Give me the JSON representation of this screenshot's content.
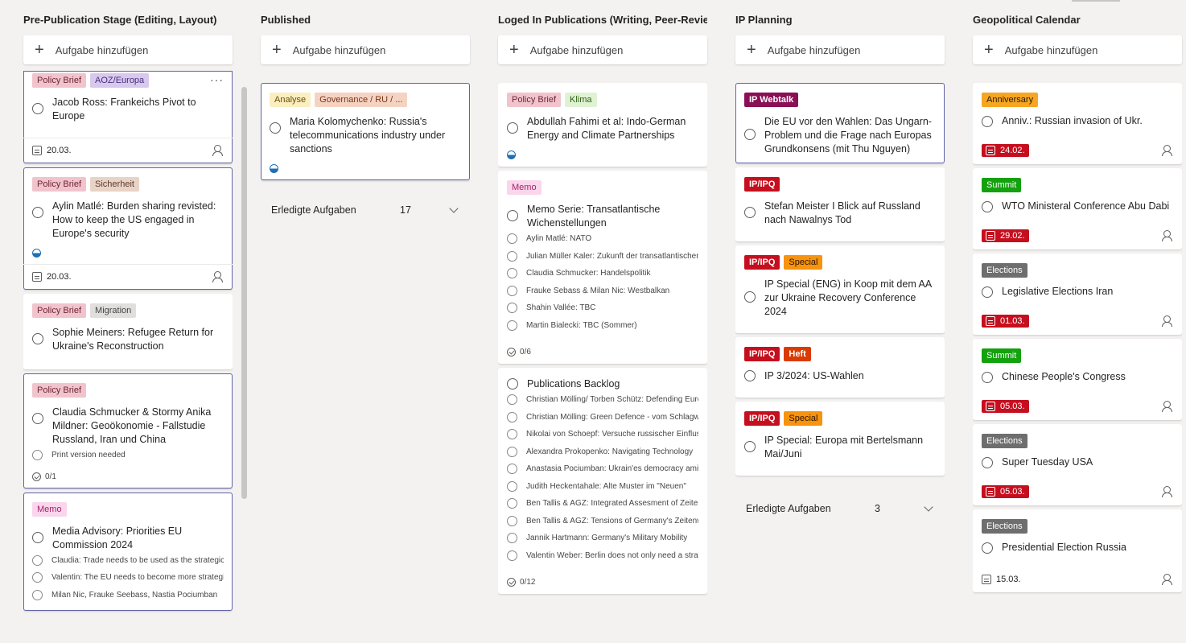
{
  "columns": [
    {
      "title": "Pre-Publication Stage (Editing, Layout)",
      "add_label": "Aufgabe hinzufügen",
      "cards": [
        {
          "labels": [
            {
              "text": "Policy Brief",
              "color": "#f1c4cd"
            },
            {
              "text": "AOZ/Europa",
              "color": "#d8c8ee"
            }
          ],
          "title": "Jacob Ross: Frankeichs Pivot to Europe",
          "date": "20.03.",
          "more": "···"
        },
        {
          "labels": [
            {
              "text": "Policy Brief",
              "color": "#f1c4cd"
            },
            {
              "text": "Sicherheit",
              "color": "#e8d3c7"
            }
          ],
          "title": "Aylin Matlé: Burden sharing revisted: How to keep the US engaged in Europe's security",
          "date": "20.03."
        },
        {
          "labels": [
            {
              "text": "Policy Brief",
              "color": "#f1c4cd"
            },
            {
              "text": "Migration",
              "color": "#e1dfdd"
            }
          ],
          "title": "Sophie Meiners: Refugee Return for Ukraine's Reconstruction"
        },
        {
          "labels": [
            {
              "text": "Policy Brief",
              "color": "#f1c4cd"
            }
          ],
          "title": "Claudia Schmucker & Stormy Anika Mildner: Geoökonomie - Fallstudie Russland, Iran und China",
          "subtasks": [
            "Print version needed"
          ],
          "checklist": "0/1"
        },
        {
          "labels": [
            {
              "text": "Memo",
              "color": "#fbd5ec"
            }
          ],
          "title": "Media Advisory: Priorities EU Commission 2024",
          "subtasks": [
            "Claudia: Trade needs to be used as the strategic tool",
            "Valentin: The EU needs to become more strategic",
            "Milan Nic, Frauke Seebass, Nastia Pociumban"
          ]
        }
      ]
    },
    {
      "title": "Published",
      "add_label": "Aufgabe hinzufügen",
      "cards": [
        {
          "labels": [
            {
              "text": "Analyse",
              "color": "#fbefc1"
            },
            {
              "text": "Governance / RU / ...",
              "color": "#f5d3c2"
            }
          ],
          "title": "Maria Kolomychenko: Russia's telecommunications industry under sanctions"
        }
      ],
      "completed_label": "Erledigte Aufgaben",
      "completed_count": "17"
    },
    {
      "title": "Loged In Publications (Writing, Peer-Review)",
      "add_label": "Aufgabe hinzufügen",
      "cards": [
        {
          "labels": [
            {
              "text": "Policy Brief",
              "color": "#f1c4cd"
            },
            {
              "text": "Klima",
              "color": "#dff3d3"
            }
          ],
          "title": "Abdullah Fahimi et al: Indo-German Energy and Climate Partnerships"
        },
        {
          "labels": [
            {
              "text": "Memo",
              "color": "#fbd5ec"
            }
          ],
          "title": "Memo Serie: Transatlantische Wichenstellungen",
          "subtasks": [
            "Aylin Matlé: NATO",
            "Julian Müller Kaler: Zukunft der transatlantischen Beziehungen",
            "Claudia Schmucker: Handelspolitik",
            "Frauke Sebass & Milan Nic: Westbalkan",
            "Shahin Vallée: TBC",
            "Martin Bialecki: TBC (Sommer)"
          ],
          "checklist": "0/6"
        },
        {
          "labels": [],
          "title": "Publications Backlog",
          "subtasks": [
            "Christian Mölling/ Torben Schütz: Defending Europe",
            "Christian Mölling: Green Defence - vom Schlagwort",
            "Nikolai von Schoepf: Versuche russischer Einflussnahme",
            "Alexandra Prokopenko: Navigating Technology",
            "Anastasia Pociumban: Ukrain'es democracy amid war",
            "Judith Heckentahale: Alte Muster im \"Neuen\"",
            "Ben Tallis & AGZ: Integrated Assesment of Zeitenwende",
            "Ben Tallis & AGZ: Tensions of Germany's Zeitenwende",
            "Jannik Hartmann: Germany's Military Mobility",
            "Valentin Weber: Berlin does not only need a strategy"
          ],
          "checklist": "0/12"
        }
      ]
    },
    {
      "title": "IP Planning",
      "add_label": "Aufgabe hinzufügen",
      "cards": [
        {
          "labels": [
            {
              "text": "IP Webtalk",
              "color": "#8a0f55"
            }
          ],
          "title": "Die EU vor den Wahlen: Das Ungarn-Problem und die Frage nach Europas Grundkonsens (mit Thu Nguyen)"
        },
        {
          "labels": [
            {
              "text": "IP/IPQ",
              "color": "#c50f1f"
            }
          ],
          "title": "Stefan Meister I Blick auf Russland nach Nawalnys Tod"
        },
        {
          "labels": [
            {
              "text": "IP/IPQ",
              "color": "#c50f1f"
            },
            {
              "text": "Special",
              "color": "#f7930e"
            }
          ],
          "title": "IP Special (ENG) in Koop mit dem AA zur Ukraine Recovery Conference 2024"
        },
        {
          "labels": [
            {
              "text": "IP/IPQ",
              "color": "#c50f1f"
            },
            {
              "text": "Heft",
              "color": "#da3b01"
            }
          ],
          "title": "IP 3/2024: US-Wahlen"
        },
        {
          "labels": [
            {
              "text": "IP/IPQ",
              "color": "#c50f1f"
            },
            {
              "text": "Special",
              "color": "#f7930e"
            }
          ],
          "title": "IP Special: Europa mit Bertelsmann Mai/Juni"
        }
      ],
      "completed_label": "Erledigte Aufgaben",
      "completed_count": "3"
    },
    {
      "title": "Geopolitical Calendar",
      "add_label": "Aufgabe hinzufügen",
      "cards": [
        {
          "labels": [
            {
              "text": "Anniversary",
              "color": "#f5a623"
            }
          ],
          "title": "Anniv.: Russian invasion of Ukr.",
          "date": "24.02."
        },
        {
          "labels": [
            {
              "text": "Summit",
              "color": "#13a10e"
            }
          ],
          "title": "WTO Ministeral Conference Abu Dabi",
          "date": "29.02."
        },
        {
          "labels": [
            {
              "text": "Elections",
              "color": "#6e6e6e"
            }
          ],
          "title": "Legislative Elections Iran",
          "date": "01.03."
        },
        {
          "labels": [
            {
              "text": "Summit",
              "color": "#13a10e"
            }
          ],
          "title": "Chinese People's Congress",
          "date": "05.03."
        },
        {
          "labels": [
            {
              "text": "Elections",
              "color": "#6e6e6e"
            }
          ],
          "title": "Super Tuesday USA",
          "date": "05.03."
        },
        {
          "labels": [
            {
              "text": "Elections",
              "color": "#6e6e6e"
            }
          ],
          "title": "Presidential Election Russia",
          "date": "15.03."
        }
      ]
    }
  ]
}
